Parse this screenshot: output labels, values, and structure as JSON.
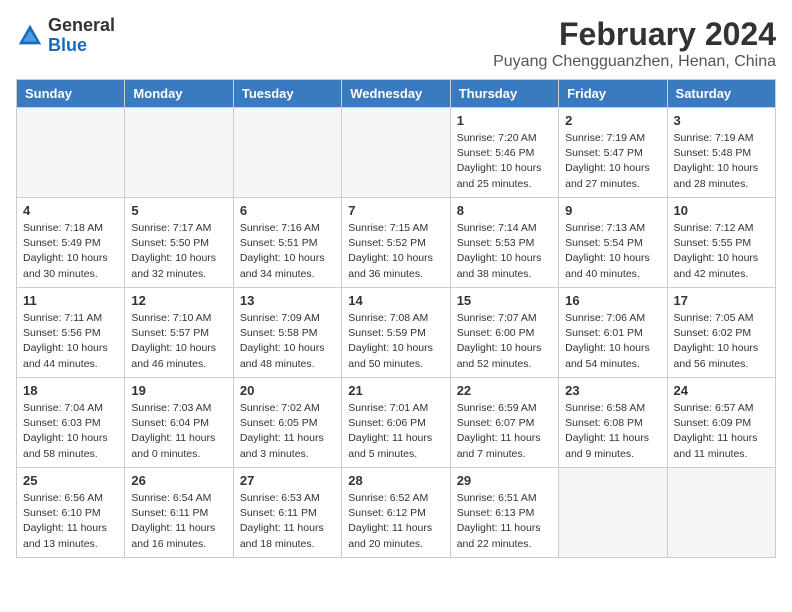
{
  "header": {
    "logo_general": "General",
    "logo_blue": "Blue",
    "title": "February 2024",
    "subtitle": "Puyang Chengguanzhen, Henan, China"
  },
  "columns": [
    "Sunday",
    "Monday",
    "Tuesday",
    "Wednesday",
    "Thursday",
    "Friday",
    "Saturday"
  ],
  "weeks": [
    [
      {
        "day": "",
        "info": ""
      },
      {
        "day": "",
        "info": ""
      },
      {
        "day": "",
        "info": ""
      },
      {
        "day": "",
        "info": ""
      },
      {
        "day": "1",
        "info": "Sunrise: 7:20 AM\nSunset: 5:46 PM\nDaylight: 10 hours\nand 25 minutes."
      },
      {
        "day": "2",
        "info": "Sunrise: 7:19 AM\nSunset: 5:47 PM\nDaylight: 10 hours\nand 27 minutes."
      },
      {
        "day": "3",
        "info": "Sunrise: 7:19 AM\nSunset: 5:48 PM\nDaylight: 10 hours\nand 28 minutes."
      }
    ],
    [
      {
        "day": "4",
        "info": "Sunrise: 7:18 AM\nSunset: 5:49 PM\nDaylight: 10 hours\nand 30 minutes."
      },
      {
        "day": "5",
        "info": "Sunrise: 7:17 AM\nSunset: 5:50 PM\nDaylight: 10 hours\nand 32 minutes."
      },
      {
        "day": "6",
        "info": "Sunrise: 7:16 AM\nSunset: 5:51 PM\nDaylight: 10 hours\nand 34 minutes."
      },
      {
        "day": "7",
        "info": "Sunrise: 7:15 AM\nSunset: 5:52 PM\nDaylight: 10 hours\nand 36 minutes."
      },
      {
        "day": "8",
        "info": "Sunrise: 7:14 AM\nSunset: 5:53 PM\nDaylight: 10 hours\nand 38 minutes."
      },
      {
        "day": "9",
        "info": "Sunrise: 7:13 AM\nSunset: 5:54 PM\nDaylight: 10 hours\nand 40 minutes."
      },
      {
        "day": "10",
        "info": "Sunrise: 7:12 AM\nSunset: 5:55 PM\nDaylight: 10 hours\nand 42 minutes."
      }
    ],
    [
      {
        "day": "11",
        "info": "Sunrise: 7:11 AM\nSunset: 5:56 PM\nDaylight: 10 hours\nand 44 minutes."
      },
      {
        "day": "12",
        "info": "Sunrise: 7:10 AM\nSunset: 5:57 PM\nDaylight: 10 hours\nand 46 minutes."
      },
      {
        "day": "13",
        "info": "Sunrise: 7:09 AM\nSunset: 5:58 PM\nDaylight: 10 hours\nand 48 minutes."
      },
      {
        "day": "14",
        "info": "Sunrise: 7:08 AM\nSunset: 5:59 PM\nDaylight: 10 hours\nand 50 minutes."
      },
      {
        "day": "15",
        "info": "Sunrise: 7:07 AM\nSunset: 6:00 PM\nDaylight: 10 hours\nand 52 minutes."
      },
      {
        "day": "16",
        "info": "Sunrise: 7:06 AM\nSunset: 6:01 PM\nDaylight: 10 hours\nand 54 minutes."
      },
      {
        "day": "17",
        "info": "Sunrise: 7:05 AM\nSunset: 6:02 PM\nDaylight: 10 hours\nand 56 minutes."
      }
    ],
    [
      {
        "day": "18",
        "info": "Sunrise: 7:04 AM\nSunset: 6:03 PM\nDaylight: 10 hours\nand 58 minutes."
      },
      {
        "day": "19",
        "info": "Sunrise: 7:03 AM\nSunset: 6:04 PM\nDaylight: 11 hours\nand 0 minutes."
      },
      {
        "day": "20",
        "info": "Sunrise: 7:02 AM\nSunset: 6:05 PM\nDaylight: 11 hours\nand 3 minutes."
      },
      {
        "day": "21",
        "info": "Sunrise: 7:01 AM\nSunset: 6:06 PM\nDaylight: 11 hours\nand 5 minutes."
      },
      {
        "day": "22",
        "info": "Sunrise: 6:59 AM\nSunset: 6:07 PM\nDaylight: 11 hours\nand 7 minutes."
      },
      {
        "day": "23",
        "info": "Sunrise: 6:58 AM\nSunset: 6:08 PM\nDaylight: 11 hours\nand 9 minutes."
      },
      {
        "day": "24",
        "info": "Sunrise: 6:57 AM\nSunset: 6:09 PM\nDaylight: 11 hours\nand 11 minutes."
      }
    ],
    [
      {
        "day": "25",
        "info": "Sunrise: 6:56 AM\nSunset: 6:10 PM\nDaylight: 11 hours\nand 13 minutes."
      },
      {
        "day": "26",
        "info": "Sunrise: 6:54 AM\nSunset: 6:11 PM\nDaylight: 11 hours\nand 16 minutes."
      },
      {
        "day": "27",
        "info": "Sunrise: 6:53 AM\nSunset: 6:11 PM\nDaylight: 11 hours\nand 18 minutes."
      },
      {
        "day": "28",
        "info": "Sunrise: 6:52 AM\nSunset: 6:12 PM\nDaylight: 11 hours\nand 20 minutes."
      },
      {
        "day": "29",
        "info": "Sunrise: 6:51 AM\nSunset: 6:13 PM\nDaylight: 11 hours\nand 22 minutes."
      },
      {
        "day": "",
        "info": ""
      },
      {
        "day": "",
        "info": ""
      }
    ]
  ]
}
